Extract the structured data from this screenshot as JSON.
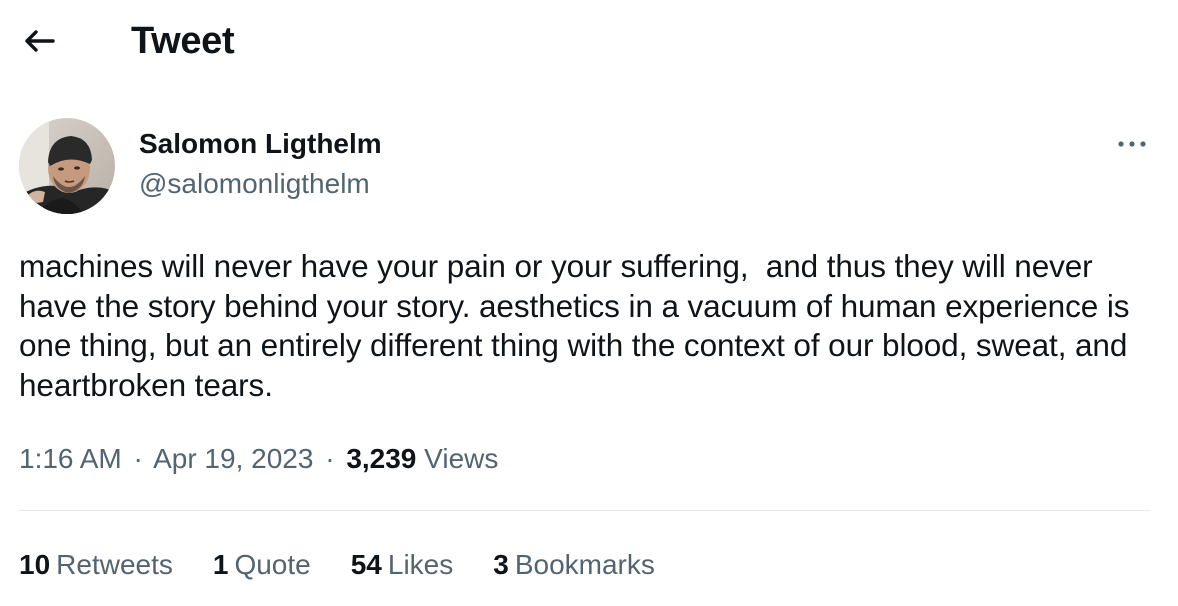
{
  "header": {
    "title": "Tweet",
    "back_icon": "arrow-left-icon"
  },
  "author": {
    "name": "Salomon Ligthelm",
    "handle": "@salomonligthelm",
    "avatar": "profile-photo"
  },
  "tweet": {
    "text": "machines will never have your pain or your suffering,  and thus they will never have the story behind your story. aesthetics in a vacuum of human experience is one thing, but an entirely different thing with the context of our blood, sweat, and heartbroken tears.",
    "time": "1:16 AM",
    "date": "Apr 19, 2023",
    "separator": "·",
    "views_count": "3,239",
    "views_label": "Views"
  },
  "stats": {
    "retweets_count": "10",
    "retweets_label": "Retweets",
    "quotes_count": "1",
    "quotes_label": "Quote",
    "likes_count": "54",
    "likes_label": "Likes",
    "bookmarks_count": "3",
    "bookmarks_label": "Bookmarks"
  },
  "colors": {
    "text_primary": "#0f1419",
    "text_secondary": "#536471",
    "divider": "#e6ebee"
  }
}
